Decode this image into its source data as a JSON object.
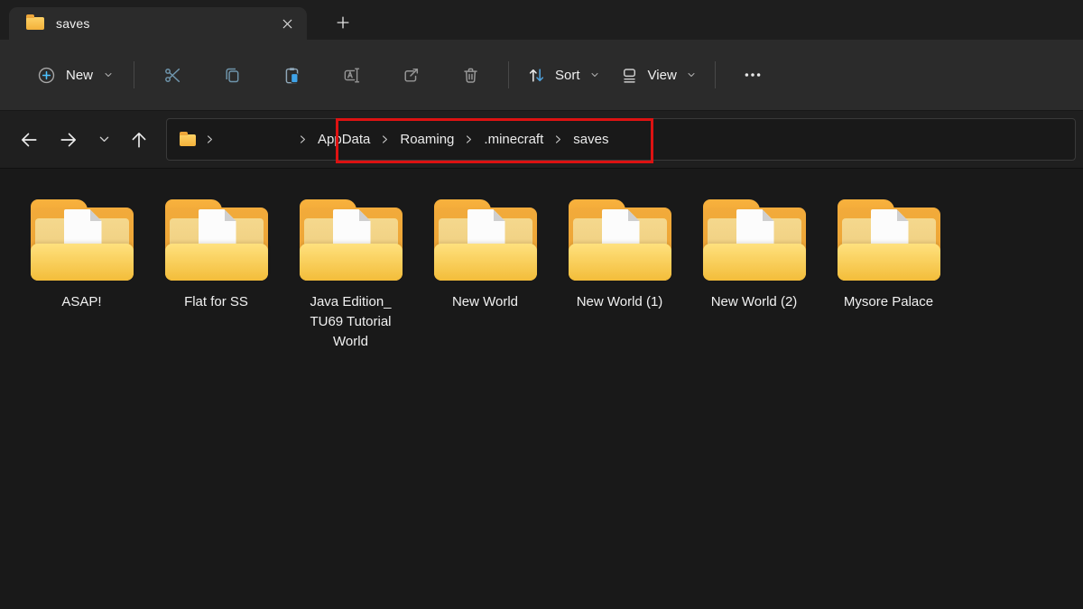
{
  "tab_bar": {
    "active_tab_title": "saves"
  },
  "toolbar": {
    "new_label": "New",
    "sort_label": "Sort",
    "view_label": "View"
  },
  "address_bar": {
    "segments": [
      "AppData",
      "Roaming",
      ".minecraft",
      "saves"
    ]
  },
  "folders": [
    {
      "name": "ASAP!"
    },
    {
      "name": "Flat for SS"
    },
    {
      "name": "Java Edition_ TU69 Tutorial World"
    },
    {
      "name": "New World"
    },
    {
      "name": "New World (1)"
    },
    {
      "name": "New World (2)"
    },
    {
      "name": "Mysore Palace"
    }
  ],
  "icons": {
    "tab": "folder-icon",
    "toolbar": [
      "plus-circle-icon",
      "cut-icon",
      "copy-icon",
      "paste-icon",
      "rename-icon",
      "share-icon",
      "delete-icon",
      "sort-arrows-icon",
      "view-icon",
      "see-more-icon"
    ],
    "navigation": [
      "back-arrow-icon",
      "forward-arrow-icon",
      "recent-locations-chevron-icon",
      "up-arrow-icon"
    ]
  },
  "colors": {
    "accent_blue": "#4cc2ff",
    "steel_blue_icons": "#6f95ac",
    "highlight_red": "#dd1212",
    "folder_yellow": "#f3bd3a",
    "toolbar_bg": "#2b2b2b",
    "window_bg": "#191919"
  }
}
